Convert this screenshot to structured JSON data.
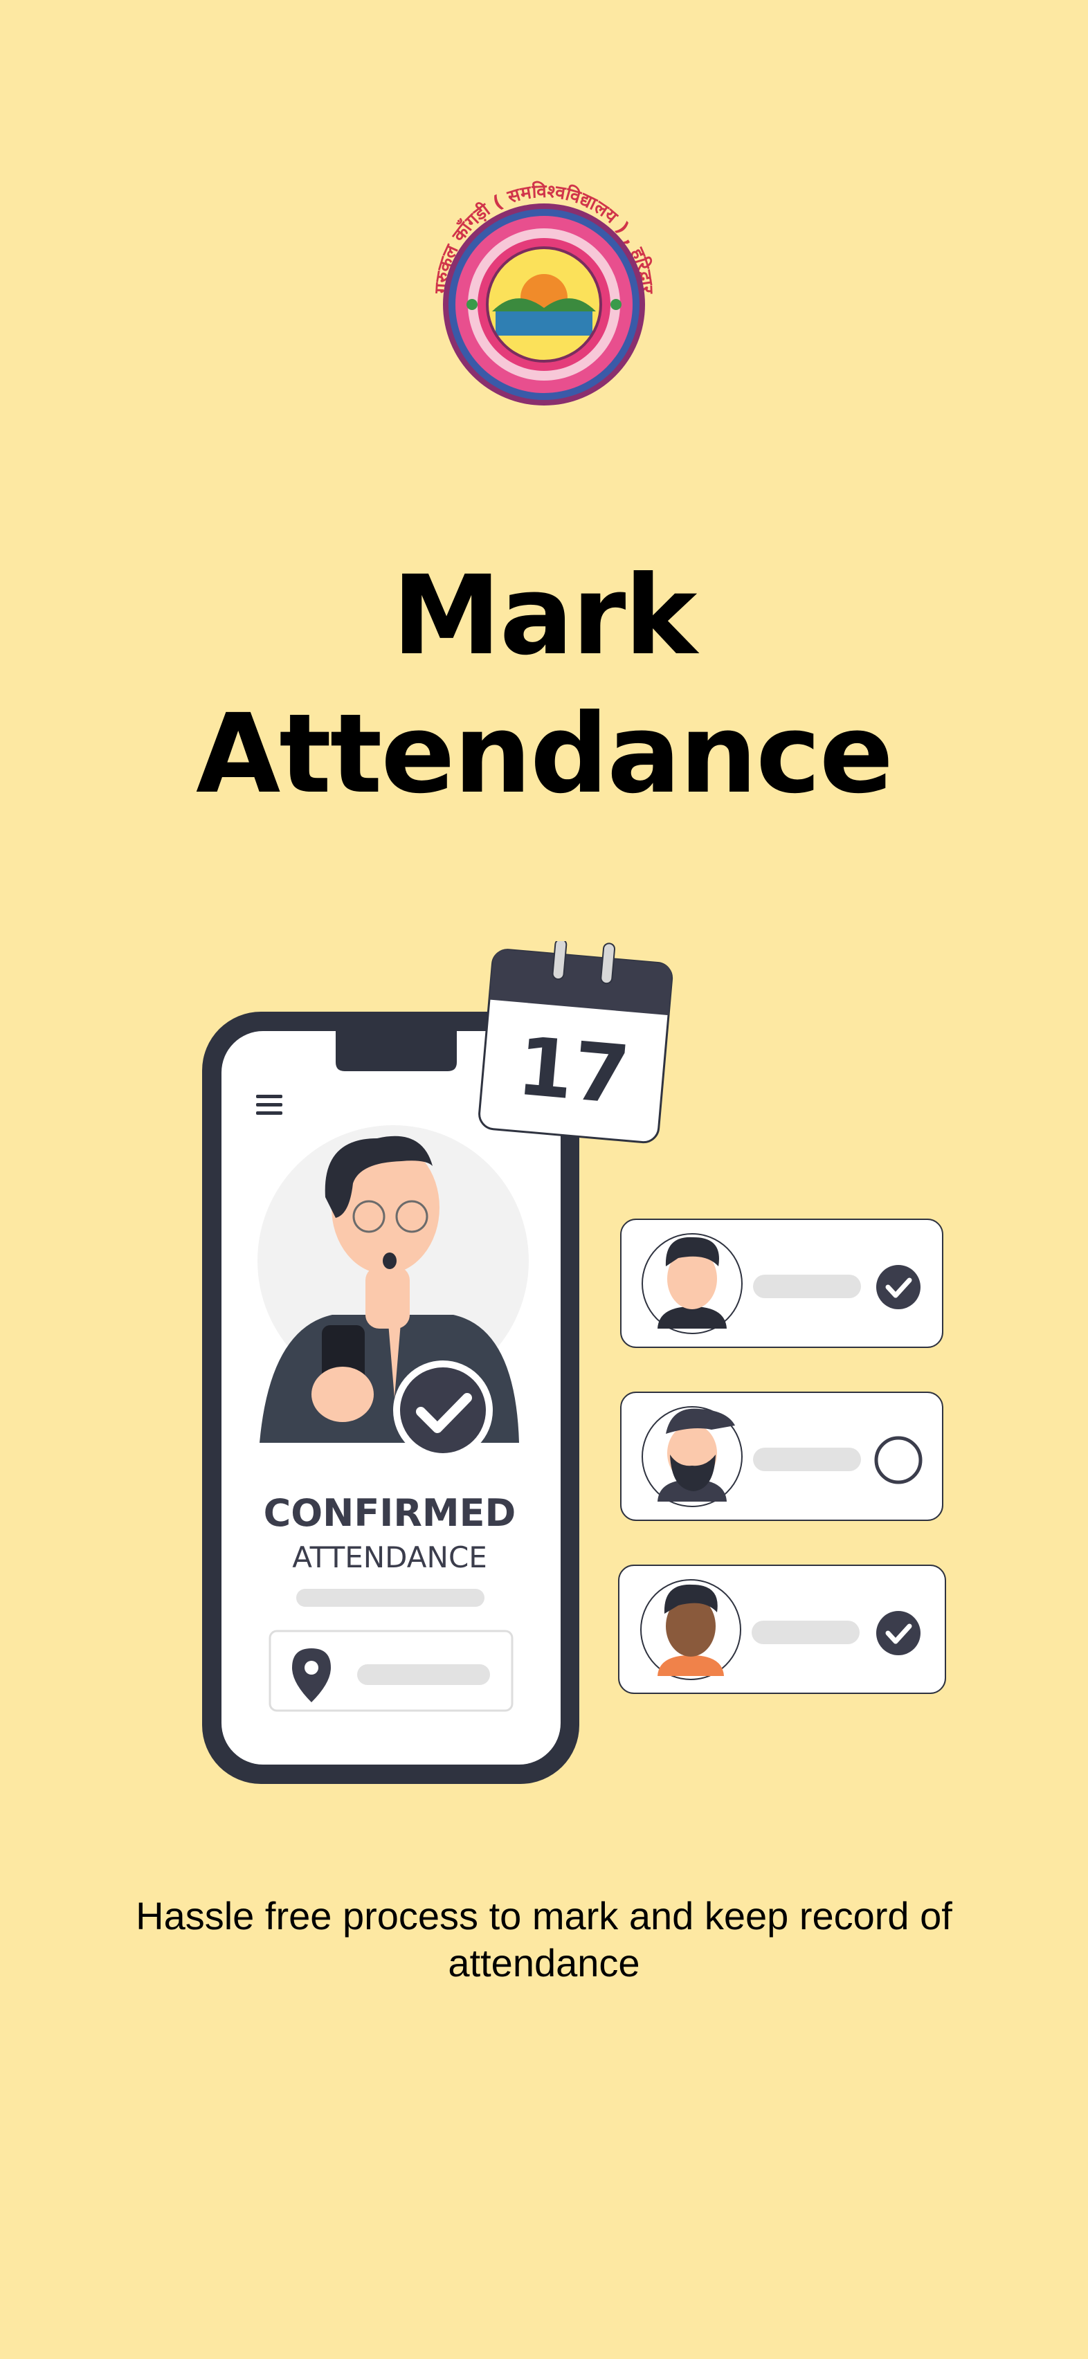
{
  "logo": {
    "ring_text": "गुरुकुल काँगड़ी ( समविश्वविद्यालय ) , हरिद्वार"
  },
  "title": {
    "line1": "Mark",
    "line2": "Attendance"
  },
  "illustration": {
    "calendar_day": "17",
    "status_main": "CONFIRMED",
    "status_sub": "ATTENDANCE",
    "attendees": [
      {
        "status": "checked"
      },
      {
        "status": "unchecked"
      },
      {
        "status": "checked"
      }
    ]
  },
  "subtitle": "Hassle free process to mark and keep record of attendance",
  "colors": {
    "background": "#fde8a2",
    "dark": "#3b3d4c",
    "phone_frame": "#2f3340"
  }
}
